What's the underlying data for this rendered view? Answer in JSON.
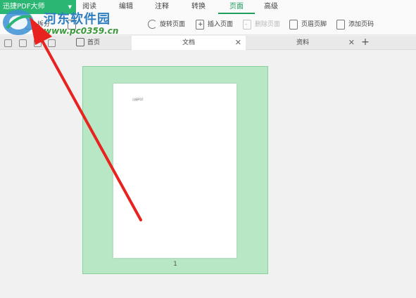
{
  "app": {
    "menu_label": "迅捷PDF大师"
  },
  "menu_tabs": [
    {
      "label": "阅读"
    },
    {
      "label": "编辑"
    },
    {
      "label": "注释"
    },
    {
      "label": "转换"
    },
    {
      "label": "页面",
      "active": true
    },
    {
      "label": "高级"
    }
  ],
  "toolbar": {
    "split_label": "拆分",
    "rotate_label": "旋转页面",
    "insert_label": "插入页面",
    "delete_label": "删除页面",
    "header_footer_label": "页眉页脚",
    "add_page_number_label": "添加页码"
  },
  "doc_tabs": {
    "home_label": "首页",
    "tabs": [
      {
        "label": "文档",
        "active": true
      },
      {
        "label": "资料",
        "active": false
      }
    ],
    "new_tab_label": "+"
  },
  "document": {
    "page_number": "1",
    "page_text": "迅捷PDF"
  },
  "watermark": {
    "site_name": "河东软件园",
    "url": "www.pc0359.cn"
  },
  "colors": {
    "accent": "#2bb673",
    "active_tab": "#1d9e5d",
    "page_frame": "#b7e7c5",
    "arrow": "#e8231f"
  }
}
